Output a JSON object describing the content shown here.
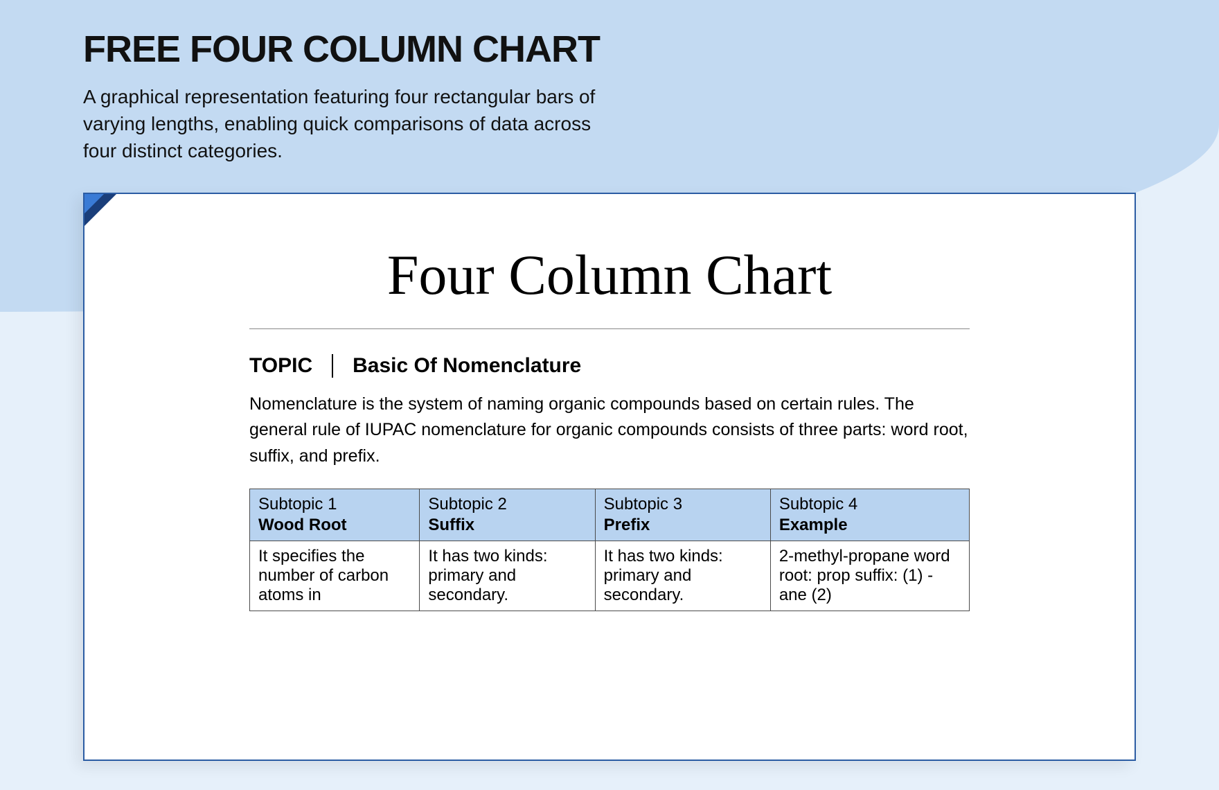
{
  "header": {
    "title": "FREE FOUR COLUMN CHART",
    "description": "A graphical representation featuring four rectangular bars of varying lengths, enabling quick comparisons of data across four distinct categories."
  },
  "document": {
    "title": "Four Column Chart",
    "topic_label": "TOPIC",
    "topic_value": "Basic Of Nomenclature",
    "intro": "Nomenclature is the system of naming organic compounds based on certain rules. The general rule of IUPAC nomenclature for organic compounds consists of three parts: word root, suffix, and prefix.",
    "columns": [
      {
        "label": "Subtopic 1",
        "name": "Wood Root",
        "body": "It specifies the number of carbon atoms in"
      },
      {
        "label": "Subtopic 2",
        "name": "Suffix",
        "body": "It has two kinds: primary and secondary."
      },
      {
        "label": "Subtopic 3",
        "name": "Prefix",
        "body": "It has two kinds: primary and secondary."
      },
      {
        "label": "Subtopic 4",
        "name": "Example",
        "body": "2-methyl-propane word root: prop suffix: (1) -ane (2)"
      }
    ]
  }
}
